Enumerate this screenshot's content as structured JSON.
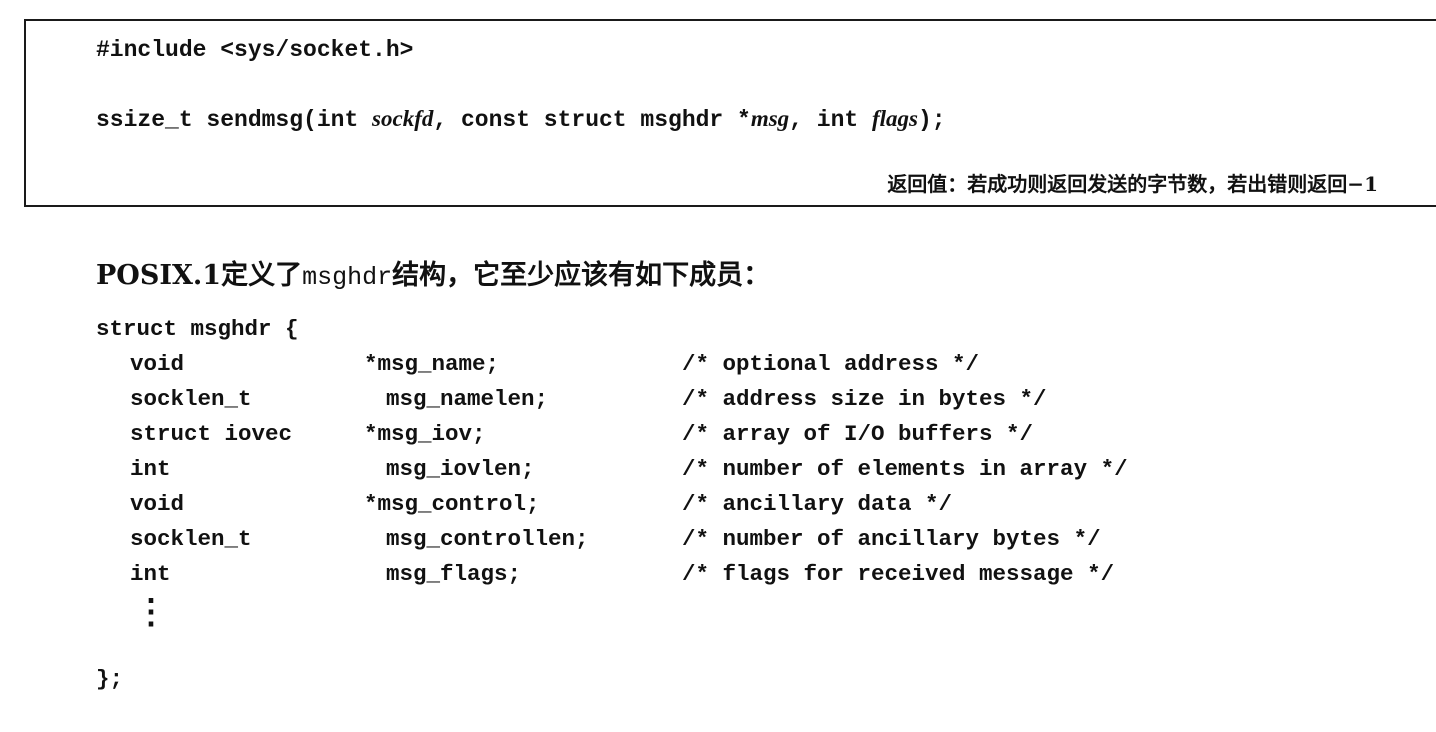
{
  "prototype_box": {
    "include_line": "#include <sys/socket.h>",
    "signature": {
      "prefix": "ssize_t sendmsg(int ",
      "param1": "sockfd",
      "mid1": ", const struct msghdr *",
      "param2": "msg",
      "mid2": ", int ",
      "param3": "flags",
      "suffix": ");"
    },
    "return_note": "返回值：若成功则返回发送的字节数，若出错则返回−1"
  },
  "intro": {
    "before": "POSIX.1定义了",
    "code": "msghdr",
    "after": "结构，它至少应该有如下成员："
  },
  "struct_def": {
    "open": "struct msghdr {",
    "members": [
      {
        "type": "void",
        "name": "*msg_name;",
        "comment": "/* optional address */"
      },
      {
        "type": "socklen_t",
        "name": "msg_namelen;",
        "comment": "/* address size in bytes */"
      },
      {
        "type": "struct iovec",
        "name": "*msg_iov;",
        "comment": "/* array of I/O buffers */"
      },
      {
        "type": "int",
        "name": "msg_iovlen;",
        "comment": "/* number of elements in array */"
      },
      {
        "type": "void",
        "name": "*msg_control;",
        "comment": "/* ancillary data */"
      },
      {
        "type": "socklen_t",
        "name": "msg_controllen;",
        "comment": "/* number of ancillary bytes */"
      },
      {
        "type": "int",
        "name": "msg_flags;",
        "comment": "/* flags for received message */"
      }
    ],
    "ellipsis": "⋮",
    "close": "};"
  }
}
